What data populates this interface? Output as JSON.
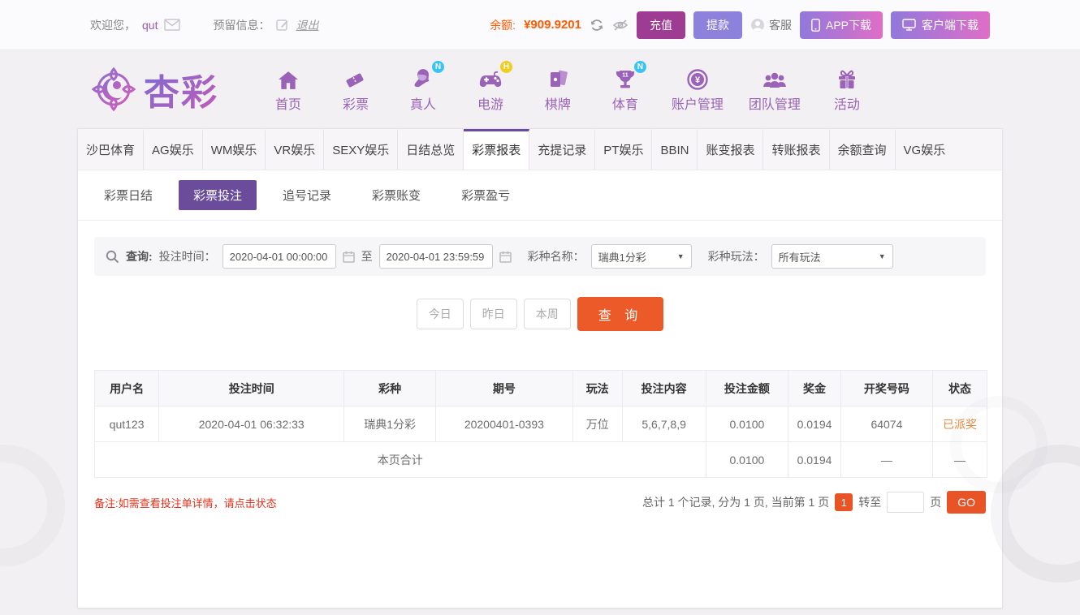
{
  "topbar": {
    "welcome": "欢迎您，",
    "username": "qut",
    "reserved_label": "预留信息：",
    "logout": "退出",
    "balance_label": "余额:",
    "balance_value": "¥909.9201",
    "recharge": "充值",
    "withdraw": "提款",
    "service": "客服",
    "app_download": "APP下载",
    "client_download": "客户端下载"
  },
  "brand": {
    "logo_text": "杏彩"
  },
  "nav": [
    {
      "label": "首页",
      "badge": ""
    },
    {
      "label": "彩票",
      "badge": ""
    },
    {
      "label": "真人",
      "badge": "N"
    },
    {
      "label": "电游",
      "badge": "H"
    },
    {
      "label": "棋牌",
      "badge": ""
    },
    {
      "label": "体育",
      "badge": "N"
    },
    {
      "label": "账户管理",
      "badge": ""
    },
    {
      "label": "团队管理",
      "badge": ""
    },
    {
      "label": "活动",
      "badge": ""
    }
  ],
  "tabs": [
    "沙巴体育",
    "AG娱乐",
    "WM娱乐",
    "VR娱乐",
    "SEXY娱乐",
    "日结总览",
    "彩票报表",
    "充提记录",
    "PT娱乐",
    "BBIN",
    "账变报表",
    "转账报表",
    "余额查询",
    "VG娱乐"
  ],
  "active_tab": "彩票报表",
  "subtabs": [
    "彩票日结",
    "彩票投注",
    "追号记录",
    "彩票账变",
    "彩票盈亏"
  ],
  "active_subtab": "彩票投注",
  "query": {
    "label": "查询:",
    "bet_time_label": "投注时间：",
    "time_from": "2020-04-01 00:00:00",
    "to_label": "至",
    "time_to": "2020-04-01 23:59:59",
    "lottery_name_label": "彩种名称：",
    "lottery_name_value": "瑞典1分彩",
    "play_label": "彩种玩法：",
    "play_value": "所有玩法",
    "today": "今日",
    "yesterday": "昨日",
    "this_week": "本周",
    "search": "查 询"
  },
  "table": {
    "headers": [
      "用户名",
      "投注时间",
      "彩种",
      "期号",
      "玩法",
      "投注内容",
      "投注金额",
      "奖金",
      "开奖号码",
      "状态"
    ],
    "rows": [
      [
        "qut123",
        "2020-04-01 06:32:33",
        "瑞典1分彩",
        "20200401-0393",
        "万位",
        "5,6,7,8,9",
        "0.0100",
        "0.0194",
        "64074",
        "已派奖"
      ]
    ],
    "total_label": "本页合计",
    "total": [
      "0.0100",
      "0.0194",
      "—",
      "—"
    ]
  },
  "footer": {
    "note": "备注:如需查看投注单详情，请点击状态",
    "pagination_text": "总计 1 个记录, 分为 1 页, 当前第 1 页",
    "current_page": "1",
    "goto_label": "转至",
    "page_label": "页",
    "go": "GO"
  },
  "colors": {
    "brand_purple": "#6b4b9f",
    "nav_purple": "#9a63b8",
    "recharge_magenta": "#9e3b92",
    "withdraw_violet": "#8c82dc",
    "accent_orange": "#eb5a28",
    "balance_orange": "#ff5a00",
    "status_orange": "#ea8a3e",
    "note_red": "#e8301a"
  }
}
